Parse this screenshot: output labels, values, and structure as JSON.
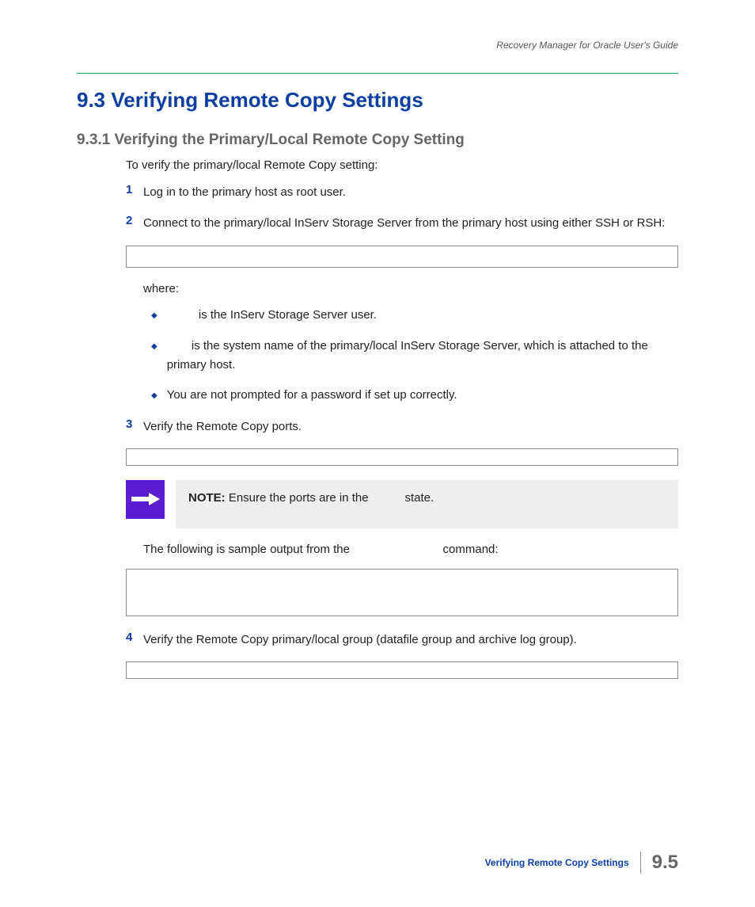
{
  "header": {
    "doc_title": "Recovery Manager for Oracle User's Guide"
  },
  "section": {
    "h1": "9.3  Verifying Remote Copy Settings",
    "h2": "9.3.1 Verifying the Primary/Local Remote Copy Setting",
    "intro": "To verify the primary/local Remote Copy setting:",
    "steps": {
      "s1": {
        "num": "1",
        "text": "Log in to the primary host as root user."
      },
      "s2": {
        "num": "2",
        "text": "Connect to the primary/local InServ Storage Server from the primary host using either SSH or RSH:"
      },
      "s3": {
        "num": "3",
        "text": "Verify the Remote Copy ports."
      },
      "s4": {
        "num": "4",
        "text": "Verify the Remote Copy primary/local group (datafile group and archive log group)."
      }
    },
    "where": "where:",
    "bullets": {
      "b1_suffix": " is the InServ Storage Server user.",
      "b2_suffix": " is the system name of the primary/local InServ Storage Server, which is attached to the primary host.",
      "b3": "You are not prompted for a password if set up correctly."
    },
    "note": {
      "label": "NOTE:",
      "text_prefix": " Ensure the ports are in the ",
      "text_suffix": " state."
    },
    "sample_para_prefix": "The following is sample output from the ",
    "sample_para_suffix": " command:"
  },
  "footer": {
    "section_title": "Verifying Remote Copy Settings",
    "page_num": "9.5"
  }
}
